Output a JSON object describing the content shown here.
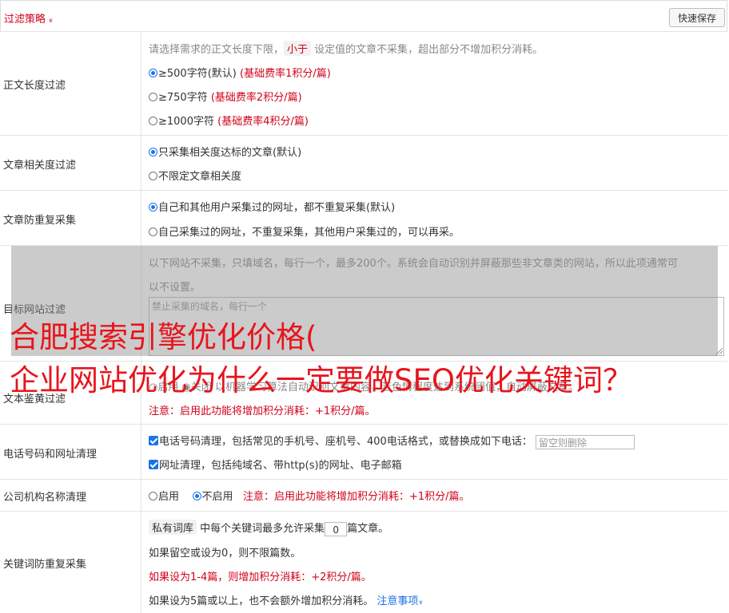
{
  "header": {
    "filter_title": "过滤策略",
    "chevron": "»",
    "save_label": "快速保存"
  },
  "length_filter": {
    "label": "正文长度过滤",
    "desc_pre": "请选择需求的正文长度下限，",
    "desc_tag": "小于",
    "desc_post": "设定值的文章不采集，超出部分不增加积分消耗。",
    "options": [
      {
        "text": "≥500字符(默认)",
        "note": "(基础费率1积分/篇)",
        "selected": true
      },
      {
        "text": "≥750字符",
        "note": "(基础费率2积分/篇)",
        "selected": false
      },
      {
        "text": "≥1000字符",
        "note": "(基础费率4积分/篇)",
        "selected": false
      }
    ]
  },
  "relevance": {
    "label": "文章相关度过滤",
    "options": [
      {
        "text": "只采集相关度达标的文章(默认)",
        "selected": true
      },
      {
        "text": "不限定文章相关度",
        "selected": false
      }
    ]
  },
  "dup_collect": {
    "label": "文章防重复采集",
    "options": [
      {
        "text": "自己和其他用户采集过的网址，都不重复采集(默认)",
        "selected": true
      },
      {
        "text": "自己采集过的网址，不重复采集，其他用户采集过的，可以再采。",
        "selected": false
      }
    ]
  },
  "target_site": {
    "label": "目标网站过滤",
    "desc1": "以下网站不采集，只填域名，每行一个，最多200个。系统会自动识别并屏蔽那些非文章类的网站，所以此项通常可",
    "desc2": "以不设置。",
    "placeholder": "禁止采集的域名，每行一个"
  },
  "porn": {
    "label": "文本鉴黄过滤",
    "line": "○启用  ◉关闭  以机器学习算法自动识别文章内容，若色情程度达到系统阈值，自动屏蔽文章。",
    "note": "注意：启用此功能将增加积分消耗：+1积分/篇。"
  },
  "phone_url": {
    "label": "电话号码和网址清理",
    "phone_text": "电话号码清理，包括常见的手机号、座机号、400电话格式，或替换成如下电话：",
    "phone_placeholder": "留空则删除",
    "url_text": "网址清理，包括纯域名、带http(s)的网址、电子邮箱"
  },
  "company": {
    "label": "公司机构名称清理",
    "enable": "启用",
    "disable": "不启用",
    "note": "注意：启用此功能将增加积分消耗：+1积分/篇。"
  },
  "keyword": {
    "label": "关键词防重复采集",
    "tag": "私有词库",
    "line1_mid": "中每个关键词最多允许采集",
    "value": "0",
    "line1_end": "篇文章。",
    "line2": "如果留空或设为0，则不限篇数。",
    "line3": "如果设为1-4篇，则增加积分消耗：+2积分/篇。",
    "line4": "如果设为5篇或以上，也不会额外增加积分消耗。",
    "notice_link": "注意事项",
    "notice_chevron": "»"
  },
  "overlay": {
    "headline1": "合肥搜索引擎优化价格(",
    "headline2": "企业网站优化为什么一定要做SEO优化关键词？"
  }
}
